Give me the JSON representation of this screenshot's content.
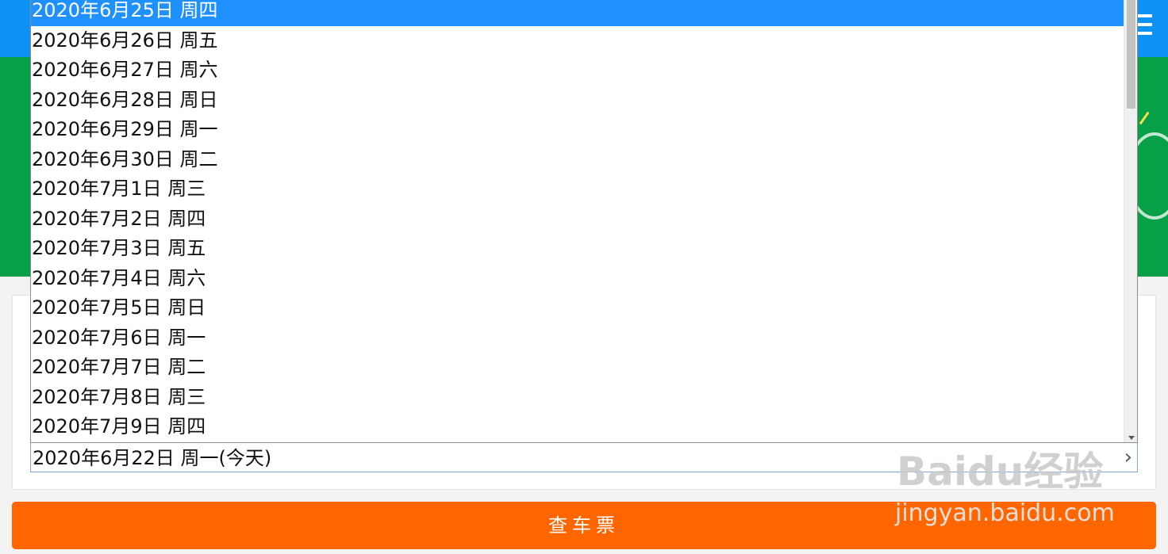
{
  "header": {
    "menu_icon": "hamburger-menu-icon"
  },
  "date_select": {
    "selected_value": "2020年6月22日 周一(今天)",
    "chevron_icon": "chevron-right-icon"
  },
  "dropdown": {
    "highlighted_index": 0,
    "options": [
      "2020年6月25日 周四",
      "2020年6月26日 周五",
      "2020年6月27日 周六",
      "2020年6月28日 周日",
      "2020年6月29日 周一",
      "2020年6月30日 周二",
      "2020年7月1日 周三",
      "2020年7月2日 周四",
      "2020年7月3日 周五",
      "2020年7月4日 周六",
      "2020年7月5日 周日",
      "2020年7月6日 周一",
      "2020年7月7日 周二",
      "2020年7月8日 周三",
      "2020年7月9日 周四"
    ]
  },
  "search_button": {
    "label": "查车票"
  },
  "watermark": {
    "logo_text": "Baidu经验",
    "url": "jingyan.baidu.com"
  },
  "colors": {
    "header_blue": "#0e93f5",
    "banner_green": "#07a046",
    "button_orange": "#ff6600",
    "highlight_blue": "#1e90ff"
  }
}
